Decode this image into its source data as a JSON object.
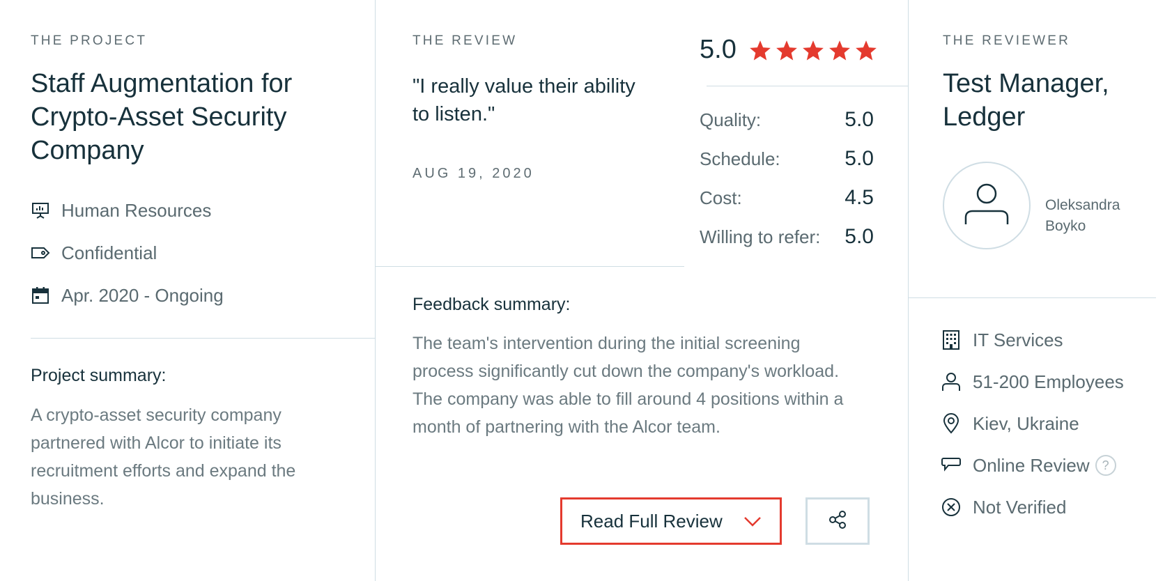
{
  "project": {
    "eyebrow": "THE PROJECT",
    "title": "Staff Augmentation for Crypto-Asset Security Company",
    "meta": [
      {
        "icon": "presentation-board-icon",
        "text": "Human Resources"
      },
      {
        "icon": "price-tag-icon",
        "text": "Confidential"
      },
      {
        "icon": "calendar-icon",
        "text": "Apr. 2020 - Ongoing"
      }
    ],
    "summary_label": "Project summary:",
    "summary_text": "A crypto-asset security company partnered with Alcor to initiate its recruitment efforts and expand the business."
  },
  "review": {
    "eyebrow": "THE REVIEW",
    "quote": "\"I really value their ability to listen.\"",
    "date": "AUG 19, 2020",
    "overall_score": "5.0",
    "stars": 5,
    "star_color": "#e43a2e",
    "ratings": [
      {
        "label": "Quality:",
        "value": "5.0"
      },
      {
        "label": "Schedule:",
        "value": "5.0"
      },
      {
        "label": "Cost:",
        "value": "4.5"
      },
      {
        "label": "Willing to refer:",
        "value": "5.0"
      }
    ],
    "feedback_label": "Feedback summary:",
    "feedback_text": "The team's intervention during the initial screening process significantly cut down the company's workload. The company was able to fill around 4 positions within a month of partnering with the Alcor team.",
    "read_full_label": "Read Full Review",
    "accent_color": "#e43a2e"
  },
  "reviewer": {
    "eyebrow": "THE REVIEWER",
    "title": "Test Manager, Ledger",
    "name": "Oleksandra Boyko",
    "info": [
      {
        "icon": "building-icon",
        "text": "IT Services"
      },
      {
        "icon": "person-icon",
        "text": "51-200 Employees"
      },
      {
        "icon": "location-pin-icon",
        "text": "Kiev, Ukraine"
      },
      {
        "icon": "speech-bubble-icon",
        "text": "Online Review",
        "help": "?"
      },
      {
        "icon": "x-circle-icon",
        "text": "Not Verified"
      }
    ]
  }
}
